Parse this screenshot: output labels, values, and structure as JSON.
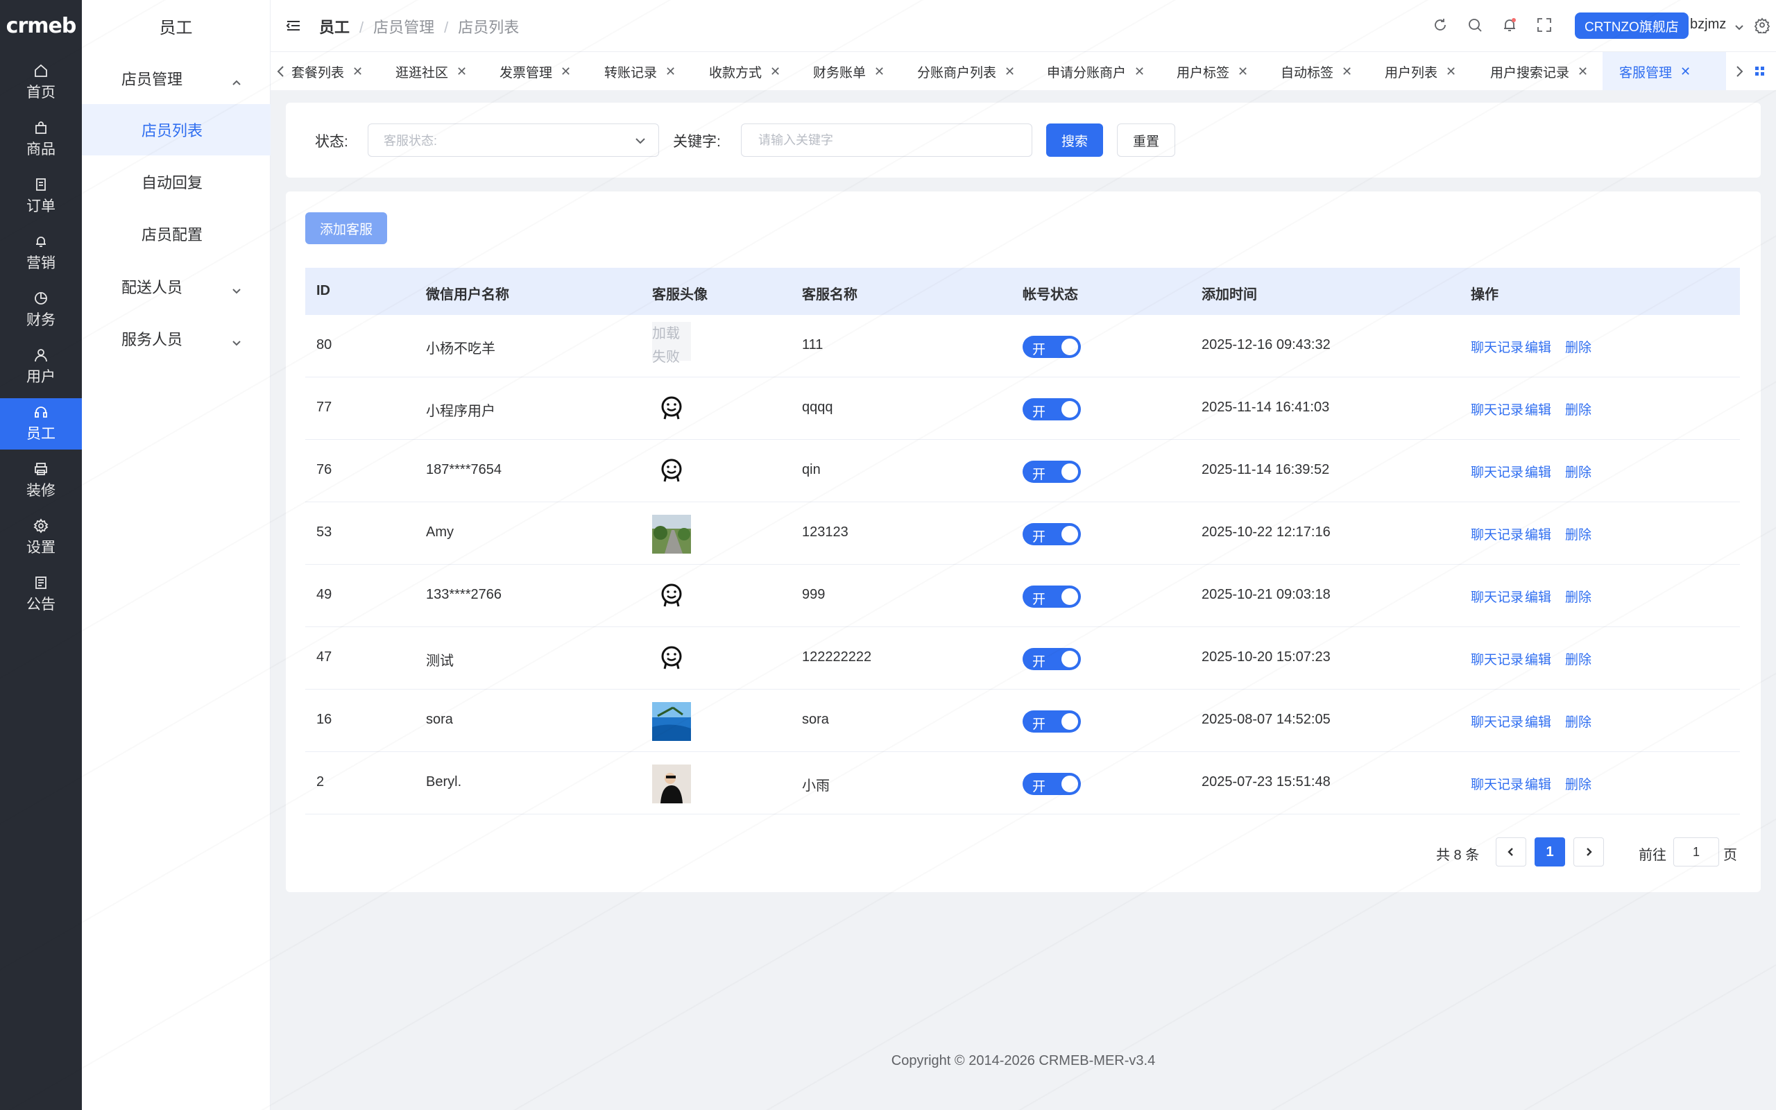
{
  "brand": {
    "logo_text": "crmeb",
    "accent": "#2f6ef0",
    "rail_bg": "#282c34"
  },
  "rail": [
    {
      "label": "首页",
      "icon": "home-icon"
    },
    {
      "label": "商品",
      "icon": "bag-icon"
    },
    {
      "label": "订单",
      "icon": "document-icon"
    },
    {
      "label": "营销",
      "icon": "bell-icon"
    },
    {
      "label": "财务",
      "icon": "pie-chart-icon"
    },
    {
      "label": "用户",
      "icon": "user-icon"
    },
    {
      "label": "员工",
      "icon": "headset-icon",
      "active": true
    },
    {
      "label": "装修",
      "icon": "printer-icon"
    },
    {
      "label": "设置",
      "icon": "gear-icon"
    },
    {
      "label": "公告",
      "icon": "notice-icon"
    }
  ],
  "subnav": {
    "title": "员工",
    "groups": [
      {
        "label": "店员管理",
        "expanded": true
      },
      {
        "label": "配送人员",
        "expanded": false
      },
      {
        "label": "服务人员",
        "expanded": false
      }
    ],
    "items": [
      {
        "label": "店员列表",
        "active": true
      },
      {
        "label": "自动回复"
      },
      {
        "label": "店员配置"
      }
    ]
  },
  "header": {
    "breadcrumb": [
      "员工",
      "店员管理",
      "店员列表"
    ],
    "store_button": "CRTNZO旗舰店",
    "username": "bzjmz"
  },
  "tabs": [
    {
      "label": "套餐列表"
    },
    {
      "label": "逛逛社区"
    },
    {
      "label": "发票管理"
    },
    {
      "label": "转账记录"
    },
    {
      "label": "收款方式"
    },
    {
      "label": "财务账单"
    },
    {
      "label": "分账商户列表"
    },
    {
      "label": "申请分账商户"
    },
    {
      "label": "用户标签"
    },
    {
      "label": "自动标签"
    },
    {
      "label": "用户列表"
    },
    {
      "label": "用户搜索记录"
    },
    {
      "label": "客服管理",
      "active": true
    }
  ],
  "filter": {
    "status_label": "状态:",
    "status_placeholder": "客服状态:",
    "keyword_label": "关键字:",
    "keyword_placeholder": "请输入关键字",
    "search_button": "搜索",
    "reset_button": "重置"
  },
  "table": {
    "add_button": "添加客服",
    "columns": [
      "ID",
      "微信用户名称",
      "客服头像",
      "客服名称",
      "帐号状态",
      "添加时间",
      "操作"
    ],
    "rows": [
      {
        "id": "80",
        "wx_name": "小杨不吃羊",
        "avatar": "load-failed",
        "name": "111",
        "status": "开",
        "time": "2025-12-16 09:43:32"
      },
      {
        "id": "77",
        "wx_name": "小程序用户",
        "avatar": "smiley-icon",
        "name": "qqqq",
        "status": "开",
        "time": "2025-11-14 16:41:03"
      },
      {
        "id": "76",
        "wx_name": "187****7654",
        "avatar": "smiley-icon",
        "name": "qin",
        "status": "开",
        "time": "2025-11-14 16:39:52"
      },
      {
        "id": "53",
        "wx_name": "Amy",
        "avatar": "photo-road",
        "name": "123123",
        "status": "开",
        "time": "2025-10-22 12:17:16"
      },
      {
        "id": "49",
        "wx_name": "133****2766",
        "avatar": "smiley-icon",
        "name": "999",
        "status": "开",
        "time": "2025-10-21 09:03:18"
      },
      {
        "id": "47",
        "wx_name": "测试",
        "avatar": "smiley-icon",
        "name": "122222222",
        "status": "开",
        "time": "2025-10-20 15:07:23"
      },
      {
        "id": "16",
        "wx_name": "sora",
        "avatar": "photo-sea",
        "name": "sora",
        "status": "开",
        "time": "2025-08-07 14:52:05"
      },
      {
        "id": "2",
        "wx_name": "Beryl.",
        "avatar": "photo-person",
        "name": "小雨",
        "status": "开",
        "time": "2025-07-23 15:51:48"
      }
    ],
    "actions": [
      "聊天记录",
      "编辑",
      "删除"
    ],
    "avatar_failed_text_1": "加载",
    "avatar_failed_text_2": "失败"
  },
  "pagination": {
    "total_text": "共 8 条",
    "current_page": "1",
    "goto_label": "前往",
    "goto_value": "1",
    "page_suffix": "页"
  },
  "footer": "Copyright © 2014-2026 CRMEB-MER-v3.4"
}
